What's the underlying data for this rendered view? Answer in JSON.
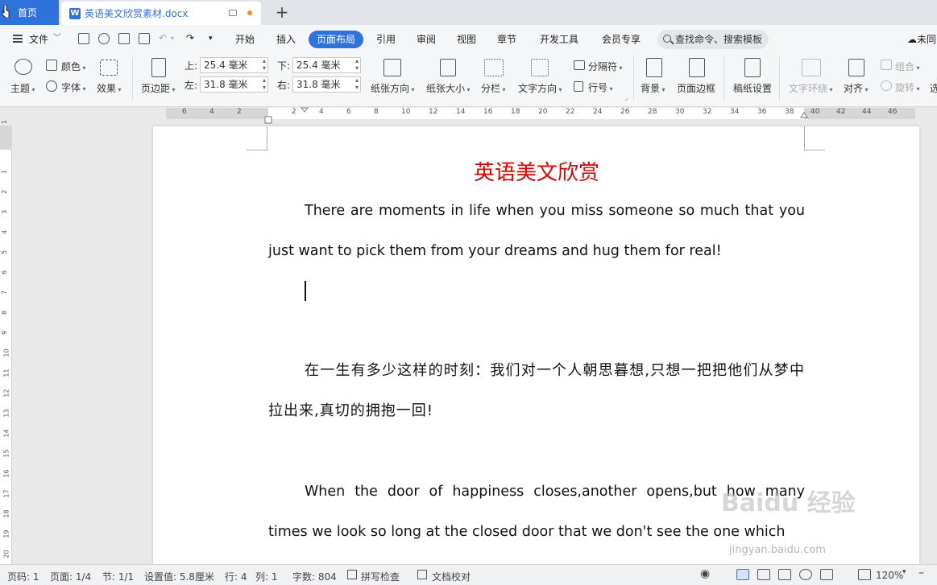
{
  "tabs": {
    "home_label": "首页",
    "doc_label": "英语美文欣赏素材.docx",
    "new_tab_label": "+"
  },
  "menu": {
    "file_label": "文件",
    "items": [
      "开始",
      "插入",
      "页面布局",
      "引用",
      "审阅",
      "视图",
      "章节",
      "开发工具",
      "会员专享"
    ],
    "active": "页面布局",
    "search_label": "查找命令、搜索模板",
    "cloud_label": "未同"
  },
  "ribbon": {
    "theme": "主题",
    "colors": "颜色",
    "fonts": "字体",
    "effects": "效果",
    "margins": "页边距",
    "top_label": "上:",
    "top_value": "25.4 毫米",
    "bottom_label": "下:",
    "bottom_value": "25.4 毫米",
    "left_label": "左:",
    "left_value": "31.8 毫米",
    "right_label": "右:",
    "right_value": "31.8 毫米",
    "orientation": "纸张方向",
    "size": "纸张大小",
    "columns": "分栏",
    "text_direction": "文字方向",
    "breaks": "分隔符",
    "line_numbers": "行号",
    "background": "背景",
    "page_border": "页面边框",
    "manuscript": "稿纸设置",
    "text_wrap": "文字环绕",
    "align": "对齐",
    "group": "组合",
    "rotate": "旋转",
    "select": "选"
  },
  "ruler": {
    "h_ticks": [
      "6",
      "4",
      "2",
      "2",
      "4",
      "6",
      "8",
      "10",
      "12",
      "14",
      "16",
      "18",
      "20",
      "22",
      "24",
      "26",
      "28",
      "30",
      "32",
      "34",
      "36",
      "38",
      "40",
      "42",
      "44",
      "46"
    ],
    "v_ticks": [
      "1",
      "1",
      "2",
      "3",
      "4",
      "5",
      "6",
      "7",
      "8",
      "9",
      "10",
      "11",
      "12",
      "13",
      "14",
      "15",
      "16",
      "17",
      "18",
      "19",
      "20"
    ]
  },
  "document": {
    "title": "英语美文欣赏",
    "p1": "There are moments in life when you miss someone so much that you just want to pick them from your dreams and hug them for real!",
    "p2": "在一生有多少这样的时刻：我们对一个人朝思暮想,只想一把把他们从梦中拉出来,真切的拥抱一回!",
    "p3": "When the door of happiness closes,another opens,but how many times we look so long at the closed door that we don't see the one which",
    "watermark": "Baidu 经验",
    "watermark_url": "jingyan.baidu.com"
  },
  "status": {
    "page_no": "页码: 1",
    "pages": "页面: 1/4",
    "section": "节: 1/1",
    "setting": "设置值: 5.8厘米",
    "row": "行: 4",
    "col": "列: 1",
    "words": "字数: 804",
    "spell": "拼写检查",
    "proof": "文档校对",
    "zoom": "120%"
  }
}
